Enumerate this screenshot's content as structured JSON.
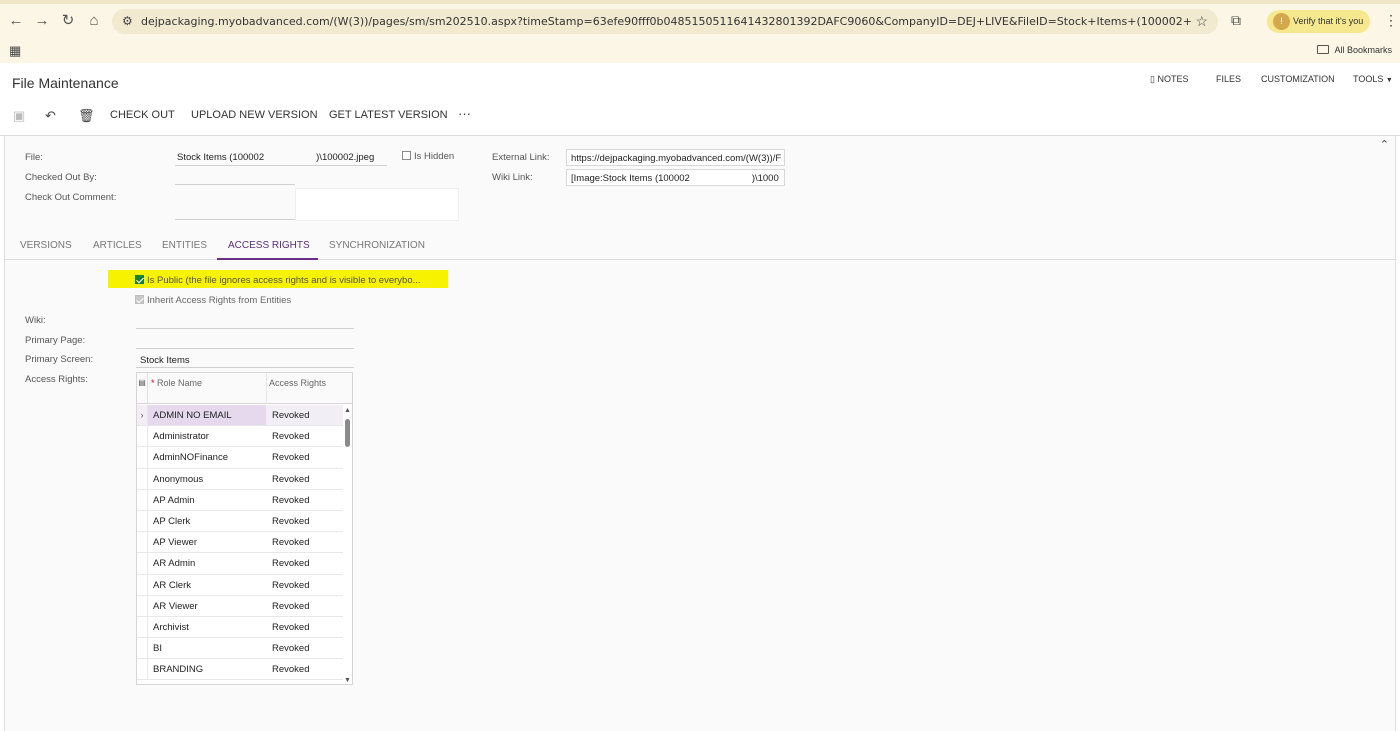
{
  "browser": {
    "url": "dejpackaging.myobadvanced.com/(W(3))/pages/sm/sm202510.aspx?timeStamp=63efe90fff0b0485150511641432801392DAFC9060&CompanyID=DEJ+LIVE&FileID=Stock+Items+(100002+++++++++++++++++++++++)%255...",
    "verify_label": "Verify that it's you",
    "all_bookmarks": "All Bookmarks"
  },
  "header": {
    "title": "File Maintenance",
    "top_actions": {
      "notes": "NOTES",
      "files": "FILES",
      "customization": "CUSTOMIZATION",
      "tools": "TOOLS"
    }
  },
  "toolbar": {
    "check_out": "CHECK OUT",
    "upload_new_version": "UPLOAD NEW VERSION",
    "get_latest_version": "GET LATEST VERSION",
    "more": "···"
  },
  "form": {
    "file_label": "File:",
    "file_value_part1": "Stock Items (100002",
    "file_value_part2": ")\\100002.jpeg",
    "is_hidden_label": "Is Hidden",
    "checked_out_by_label": "Checked Out By:",
    "check_out_comment_label": "Check Out Comment:",
    "external_link_label": "External Link:",
    "external_link_value": "https://dejpackaging.myobadvanced.com/(W(3))/F",
    "wiki_link_label": "Wiki Link:",
    "wiki_link_value_part1": "[Image:Stock Items (100002",
    "wiki_link_value_part2": ")\\1000"
  },
  "tabs": [
    "VERSIONS",
    "ARTICLES",
    "ENTITIES",
    "ACCESS RIGHTS",
    "SYNCHRONIZATION"
  ],
  "access": {
    "is_public_label": "Is Public (the file ignores access rights and is visible to everybo...",
    "is_public_checked": true,
    "inherit_label": "Inherit Access Rights from Entities",
    "wiki_label": "Wiki:",
    "primary_page_label": "Primary Page:",
    "primary_screen_label": "Primary Screen:",
    "primary_screen_value": "Stock Items",
    "access_rights_label": "Access Rights:",
    "grid": {
      "col_role": "Role Name",
      "col_access": "Access Rights",
      "rows": [
        {
          "role": "ADMIN NO EMAIL",
          "access": "Revoked"
        },
        {
          "role": "Administrator",
          "access": "Revoked"
        },
        {
          "role": "AdminNOFinance",
          "access": "Revoked"
        },
        {
          "role": "Anonymous",
          "access": "Revoked"
        },
        {
          "role": "AP Admin",
          "access": "Revoked"
        },
        {
          "role": "AP Clerk",
          "access": "Revoked"
        },
        {
          "role": "AP Viewer",
          "access": "Revoked"
        },
        {
          "role": "AR Admin",
          "access": "Revoked"
        },
        {
          "role": "AR Clerk",
          "access": "Revoked"
        },
        {
          "role": "AR Viewer",
          "access": "Revoked"
        },
        {
          "role": "Archivist",
          "access": "Revoked"
        },
        {
          "role": "BI",
          "access": "Revoked"
        },
        {
          "role": "BRANDING",
          "access": "Revoked"
        }
      ]
    }
  },
  "colors": {
    "accent": "#6b2f8b",
    "highlight": "#f7f200",
    "checkbox": "#1a7f37"
  }
}
